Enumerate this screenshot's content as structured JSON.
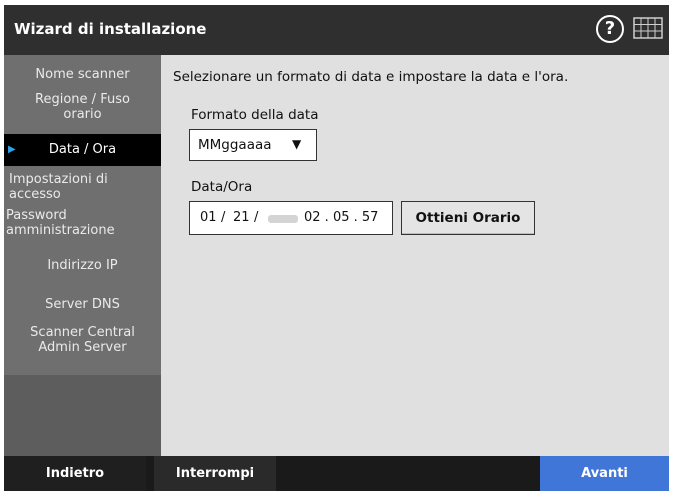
{
  "window": {
    "title": "Wizard di installazione"
  },
  "header": {
    "help_symbol": "?",
    "icons": [
      "help-icon",
      "keyboard-icon"
    ]
  },
  "sidebar": {
    "items": [
      {
        "label": "Nome scanner",
        "active": false
      },
      {
        "label": "Regione / Fuso orario",
        "active": false
      },
      {
        "label": "Data / Ora",
        "active": true
      },
      {
        "label": "Impostazioni di accesso",
        "active": false
      },
      {
        "label": "Password amministrazione",
        "active": false
      },
      {
        "label": "Indirizzo IP",
        "active": false
      },
      {
        "label": "Server DNS",
        "active": false
      },
      {
        "label": "Scanner Central Admin Server",
        "active": false
      }
    ],
    "active_marker": "▶"
  },
  "main": {
    "instruction": "Selezionare un formato di data e impostare la data e l'ora.",
    "date_format": {
      "label": "Formato della data",
      "value": "MMggaaaa",
      "caret": "▼"
    },
    "datetime": {
      "label": "Data/Ora",
      "month": "01",
      "day": "21",
      "separator": "/",
      "time": "02 . 05 . 57"
    },
    "get_time_button": "Ottieni Orario"
  },
  "footer": {
    "back": "Indietro",
    "cancel": "Interrompi",
    "next": "Avanti"
  },
  "colors": {
    "accent": "#3f76d8",
    "active_marker": "#2aa3e8"
  }
}
